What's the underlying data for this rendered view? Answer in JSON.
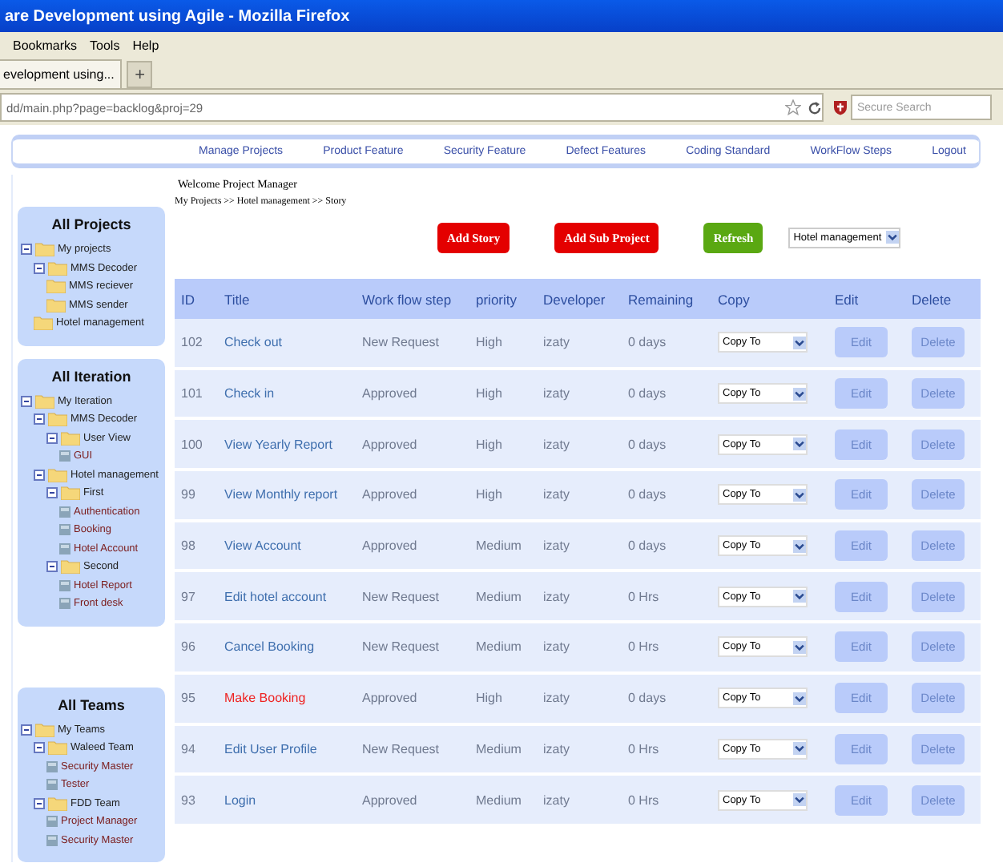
{
  "window": {
    "title": "are Development using Agile - Mozilla Firefox"
  },
  "menu": [
    "Bookmarks",
    "Tools",
    "Help"
  ],
  "tab": {
    "label": "evelopment using...",
    "new_tab": "+"
  },
  "address_bar": {
    "url": "dd/main.php?page=backlog&proj=29"
  },
  "search": {
    "placeholder": "Secure Search"
  },
  "nav": [
    "Manage Projects",
    "Product Feature",
    "Security Feature",
    "Defect Features",
    "Coding Standard",
    "WorkFlow Steps",
    "Logout"
  ],
  "sidebar": [
    {
      "title": "All Projects",
      "tree": [
        {
          "label": "My projects",
          "kind": "folder",
          "children": [
            {
              "label": "MMS Decoder",
              "kind": "folder",
              "children": [
                {
                  "label": "MMS reciever",
                  "kind": "folder"
                },
                {
                  "label": "MMS sender",
                  "kind": "folder"
                }
              ]
            },
            {
              "label": "Hotel management",
              "kind": "folder"
            }
          ]
        }
      ]
    },
    {
      "title": "All Iteration",
      "tree": [
        {
          "label": "My Iteration",
          "kind": "folder",
          "children": [
            {
              "label": "MMS Decoder",
              "kind": "folder",
              "children": [
                {
                  "label": "User View",
                  "kind": "folder",
                  "children": [
                    {
                      "label": "GUI",
                      "kind": "item"
                    }
                  ]
                }
              ]
            },
            {
              "label": "Hotel management",
              "kind": "folder",
              "children": [
                {
                  "label": "First",
                  "kind": "folder",
                  "children": [
                    {
                      "label": "Authentication",
                      "kind": "item"
                    },
                    {
                      "label": "Booking",
                      "kind": "item"
                    },
                    {
                      "label": "Hotel Account",
                      "kind": "item"
                    }
                  ]
                },
                {
                  "label": "Second",
                  "kind": "folder",
                  "children": [
                    {
                      "label": "Hotel Report",
                      "kind": "item"
                    },
                    {
                      "label": "Front desk",
                      "kind": "item"
                    }
                  ]
                }
              ]
            }
          ]
        }
      ]
    },
    {
      "title": "All Teams",
      "tree": [
        {
          "label": "My Teams",
          "kind": "folder",
          "children": [
            {
              "label": "Waleed Team",
              "kind": "folder",
              "children": [
                {
                  "label": "Security Master",
                  "kind": "item"
                },
                {
                  "label": "Tester",
                  "kind": "item"
                }
              ]
            },
            {
              "label": "FDD Team",
              "kind": "folder",
              "children": [
                {
                  "label": "Project Manager",
                  "kind": "item"
                },
                {
                  "label": "Security Master",
                  "kind": "item"
                }
              ]
            }
          ]
        }
      ]
    }
  ],
  "welcome": "Welcome Project Manager",
  "breadcrumb": "My Projects >> Hotel management >> Story",
  "actions": [
    {
      "label": "Add Story",
      "kind": "danger"
    },
    {
      "label": "Add Sub Project",
      "kind": "danger"
    },
    {
      "label": "Refresh",
      "kind": "success"
    }
  ],
  "project_select": {
    "value": "Hotel management"
  },
  "table": {
    "columns": [
      "ID",
      "Title",
      "Work flow step",
      "priority",
      "Developer",
      "Remaining",
      "Copy",
      "Edit",
      "Delete"
    ],
    "rows": [
      {
        "id": "102",
        "title": "Check out",
        "color": "#3f6fae",
        "step": "New Request",
        "priority": "High",
        "developer": "izaty",
        "remaining": "0 days",
        "copy": "Copy To",
        "edit": "Edit",
        "delete": "Delete"
      },
      {
        "id": "101",
        "title": "Check in",
        "color": "#3f6fae",
        "step": "Approved",
        "priority": "High",
        "developer": "izaty",
        "remaining": "0 days",
        "copy": "Copy To",
        "edit": "Edit",
        "delete": "Delete"
      },
      {
        "id": "100",
        "title": "View Yearly Report",
        "color": "#3f6fae",
        "step": "Approved",
        "priority": "High",
        "developer": "izaty",
        "remaining": "0 days",
        "copy": "Copy To",
        "edit": "Edit",
        "delete": "Delete"
      },
      {
        "id": "99",
        "title": "View Monthly report",
        "color": "#3f6fae",
        "step": "Approved",
        "priority": "High",
        "developer": "izaty",
        "remaining": "0 days",
        "copy": "Copy To",
        "edit": "Edit",
        "delete": "Delete"
      },
      {
        "id": "98",
        "title": "View Account",
        "color": "#3f6fae",
        "step": "Approved",
        "priority": "Medium",
        "developer": "izaty",
        "remaining": "0 days",
        "copy": "Copy To",
        "edit": "Edit",
        "delete": "Delete"
      },
      {
        "id": "97",
        "title": "Edit hotel account",
        "color": "#3f6fae",
        "step": "New Request",
        "priority": "Medium",
        "developer": "izaty",
        "remaining": "0 Hrs",
        "copy": "Copy To",
        "edit": "Edit",
        "delete": "Delete"
      },
      {
        "id": "96",
        "title": "Cancel Booking",
        "color": "#3f6fae",
        "step": "New Request",
        "priority": "Medium",
        "developer": "izaty",
        "remaining": "0 Hrs",
        "copy": "Copy To",
        "edit": "Edit",
        "delete": "Delete"
      },
      {
        "id": "95",
        "title": "Make Booking",
        "color": "#ee2222",
        "step": "Approved",
        "priority": "High",
        "developer": "izaty",
        "remaining": "0 days",
        "copy": "Copy To",
        "edit": "Edit",
        "delete": "Delete"
      },
      {
        "id": "94",
        "title": "Edit User Profile",
        "color": "#3f6fae",
        "step": "New Request",
        "priority": "Medium",
        "developer": "izaty",
        "remaining": "0 Hrs",
        "copy": "Copy To",
        "edit": "Edit",
        "delete": "Delete"
      },
      {
        "id": "93",
        "title": "Login",
        "color": "#3f6fae",
        "step": "Approved",
        "priority": "Medium",
        "developer": "izaty",
        "remaining": "0 Hrs",
        "copy": "Copy To",
        "edit": "Edit",
        "delete": "Delete"
      }
    ]
  }
}
